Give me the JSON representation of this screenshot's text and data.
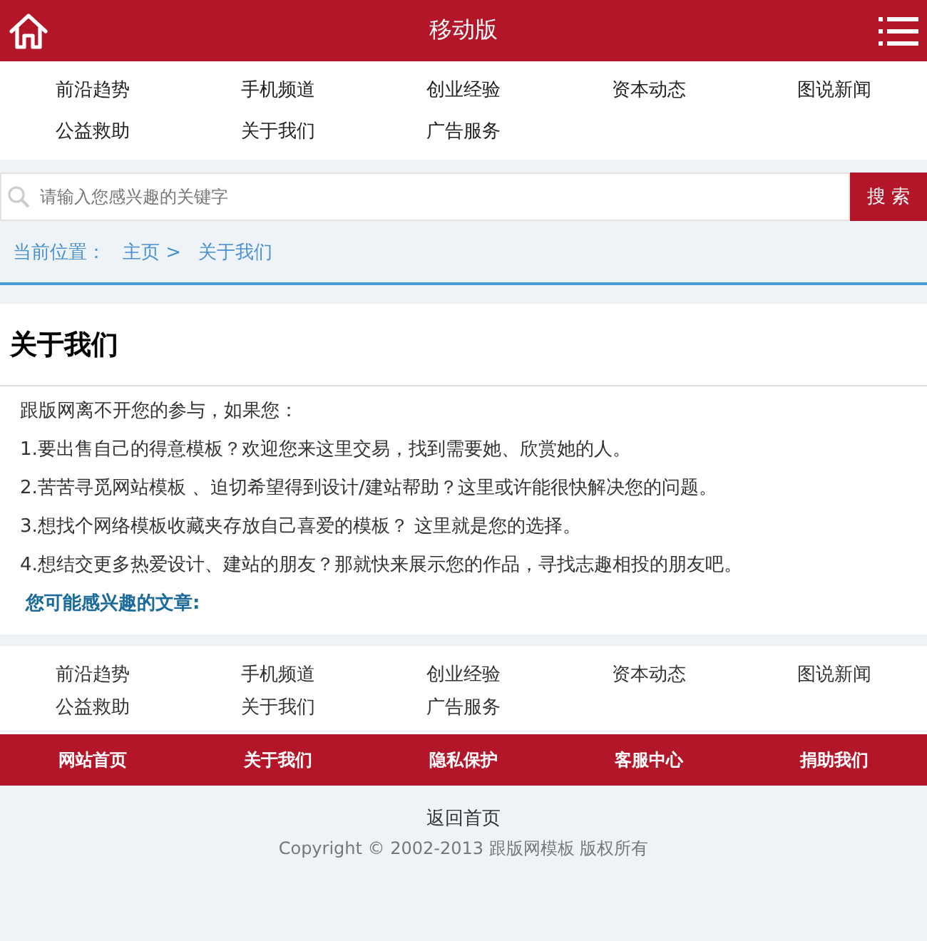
{
  "header": {
    "title": "移动版"
  },
  "nav": [
    "前沿趋势",
    "手机频道",
    "创业经验",
    "资本动态",
    "图说新闻",
    "公益救助",
    "关于我们",
    "广告服务"
  ],
  "search": {
    "placeholder": "请输入您感兴趣的关键字",
    "button": "搜 索"
  },
  "breadcrumb": {
    "label": "当前位置：",
    "items": [
      "主页 >",
      "关于我们"
    ]
  },
  "article": {
    "title": "关于我们",
    "paragraphs": [
      "跟版网离不开您的参与，如果您：",
      "1.要出售自己的得意模板？欢迎您来这里交易，找到需要她、欣赏她的人。",
      "2.苦苦寻觅网站模板 、迫切希望得到设计/建站帮助？这里或许能很快解决您的问题。",
      "3.想找个网络模板收藏夹存放自己喜爱的模板？ 这里就是您的选择。",
      "4.想结交更多热爱设计、建站的朋友？那就快来展示您的作品，寻找志趣相投的朋友吧。"
    ],
    "related_heading": "您可能感兴趣的文章:"
  },
  "footer_nav": [
    "前沿趋势",
    "手机频道",
    "创业经验",
    "资本动态",
    "图说新闻",
    "公益救助",
    "关于我们",
    "广告服务"
  ],
  "footer_bar": [
    "网站首页",
    "关于我们",
    "隐私保护",
    "客服中心",
    "捐助我们"
  ],
  "back_link": "返回首页",
  "copyright": "Copyright © 2002-2013 跟版网模板 版权所有"
}
